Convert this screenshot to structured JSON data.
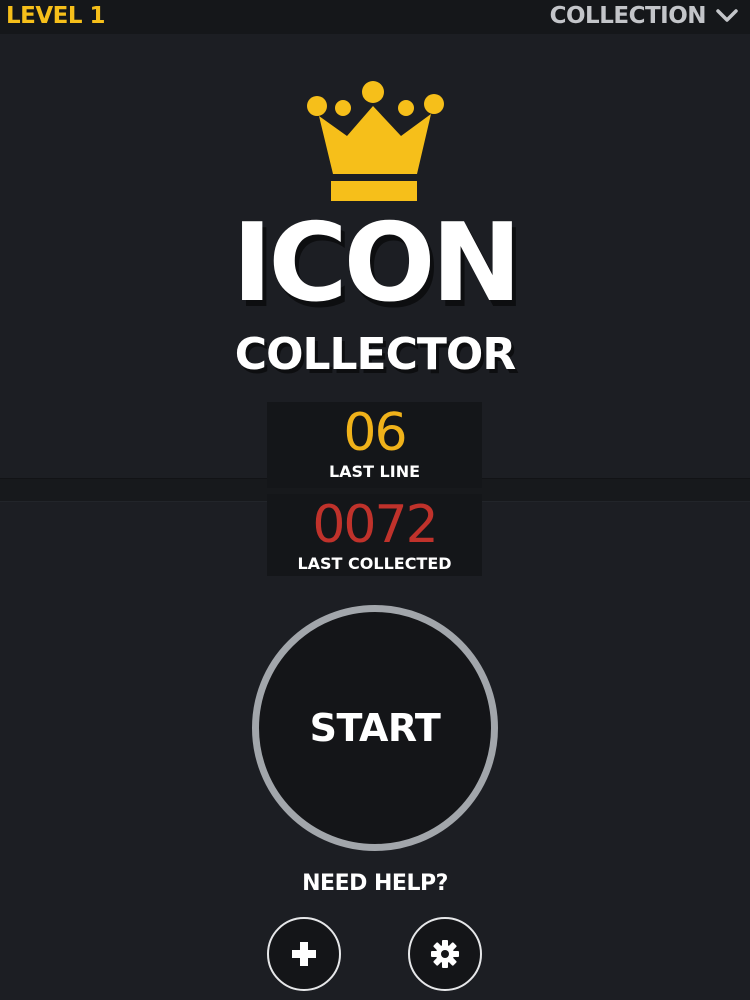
{
  "topbar": {
    "level_label": "LEVEL 1",
    "collection_label": "COLLECTION",
    "menu_icon": "chevron-down-icon"
  },
  "logo": {
    "icon": "crown-icon",
    "title_main": "ICON",
    "title_sub": "COLLECTOR"
  },
  "stats": {
    "last_line": {
      "value": "06",
      "label": "LAST LINE"
    },
    "last_collected": {
      "value": "0072",
      "label": "LAST COLLECTED"
    }
  },
  "start": {
    "label": "START"
  },
  "help": {
    "text": "NEED HELP?",
    "buttons": [
      {
        "icon": "plus-icon"
      },
      {
        "icon": "gear-icon"
      }
    ]
  },
  "colors": {
    "background": "#1c1e23",
    "accent_yellow": "#f6bf1a",
    "accent_red": "#c0322b",
    "ring_gray": "#a2a6ab"
  }
}
